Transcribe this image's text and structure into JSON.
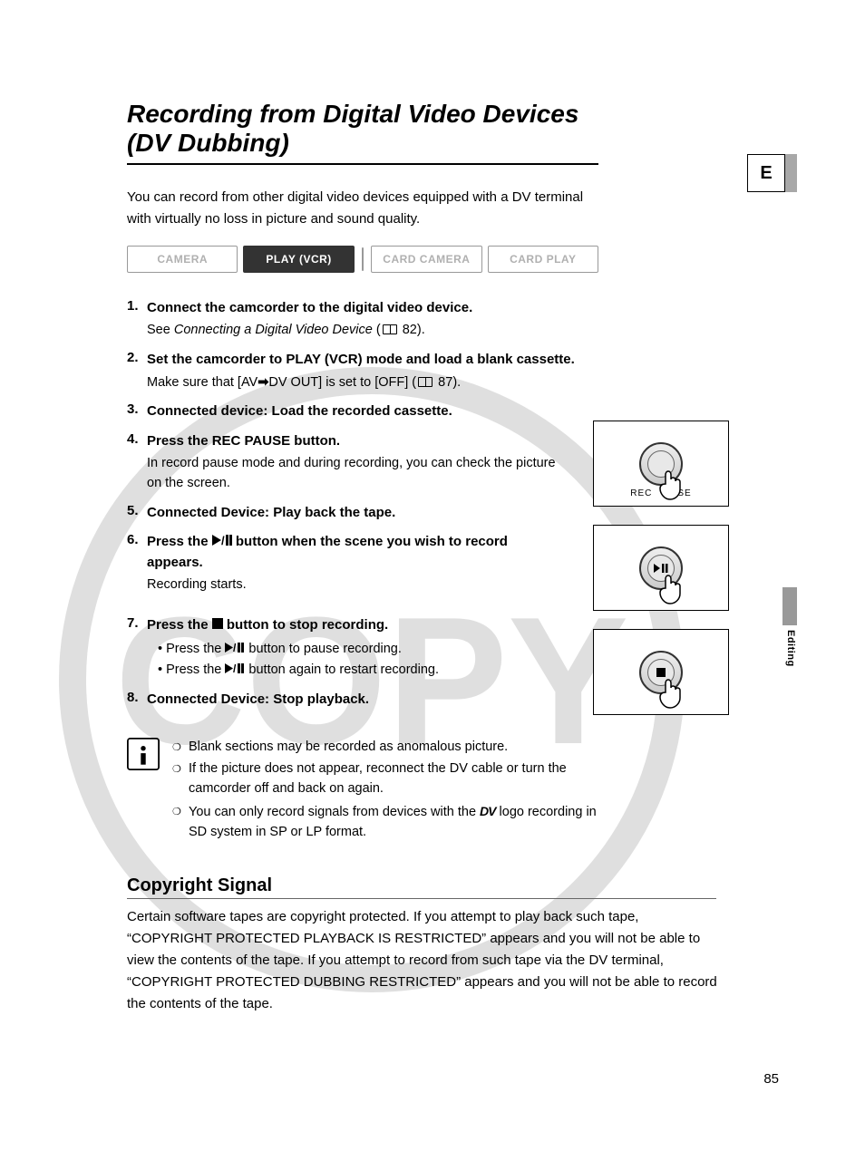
{
  "page_tab": "E",
  "side_label": "Editing",
  "page_number": "85",
  "title": "Recording from Digital Video Devices (DV Dubbing)",
  "intro": "You can record from other digital video devices equipped with a DV terminal with virtually no loss in picture and sound quality.",
  "modes": {
    "camera": "CAMERA",
    "play_vcr": "PLAY (VCR)",
    "card_camera": "CARD CAMERA",
    "card_play": "CARD PLAY"
  },
  "steps": {
    "s1": {
      "title": "Connect the camcorder to the digital video device.",
      "sub_pre": "See ",
      "sub_ital": "Connecting a Digital Video Device",
      "sub_post": " (",
      "ref": "82",
      "sub_end": ")."
    },
    "s2": {
      "title": "Set the camcorder to PLAY (VCR) mode and load a blank cassette.",
      "sub_pre": "Make sure that [AV",
      "sub_mid": "DV OUT] is set to [OFF] (",
      "ref": "87",
      "sub_end": ")."
    },
    "s3": {
      "title": "Connected device: Load the recorded cassette."
    },
    "s4": {
      "title": "Press the REC PAUSE button.",
      "sub": "In record pause mode and during recording, you can check the picture on the screen."
    },
    "s5": {
      "title": "Connected Device: Play back the tape."
    },
    "s6": {
      "title_pre": "Press the ",
      "title_post": " button when the scene you wish to record appears.",
      "sub": "Recording starts."
    },
    "s7": {
      "title_pre": "Press the ",
      "title_post": " button to stop recording.",
      "b1_pre": "Press the ",
      "b1_post": " button to pause recording.",
      "b2_pre": "Press the ",
      "b2_post": " button again to restart recording."
    },
    "s8": {
      "title": "Connected Device: Stop playback."
    }
  },
  "fig": {
    "rec_pause": "REC PAUSE"
  },
  "notes": {
    "n1": "Blank sections may be recorded as anomalous picture.",
    "n2": "If the picture does not appear, reconnect the DV cable or turn the camcorder off and back on again.",
    "n3_pre": "You can only record signals from devices with the ",
    "n3_post": " logo recording in SD system in SP or LP format."
  },
  "section2": {
    "heading": "Copyright Signal",
    "body": "Certain software tapes are copyright protected. If you attempt to play back such tape, “COPYRIGHT PROTECTED PLAYBACK IS RESTRICTED” appears and you will not be able to view the contents of the tape. If you attempt to record from such tape via the DV terminal, “COPYRIGHT PROTECTED DUBBING RESTRICTED” appears and you will not be able to record the contents of the tape."
  }
}
